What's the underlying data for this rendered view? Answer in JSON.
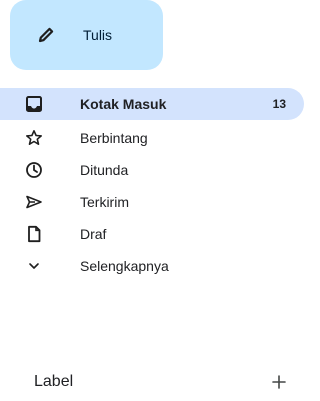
{
  "compose": {
    "label": "Tulis",
    "icon": "pencil-icon"
  },
  "nav": [
    {
      "label": "Kotak Masuk",
      "icon": "inbox-icon",
      "count": "13",
      "active": true
    },
    {
      "label": "Berbintang",
      "icon": "star-icon"
    },
    {
      "label": "Ditunda",
      "icon": "clock-icon"
    },
    {
      "label": "Terkirim",
      "icon": "send-icon"
    },
    {
      "label": "Draf",
      "icon": "draft-icon"
    },
    {
      "label": "Selengkapnya",
      "icon": "chevron-down-icon"
    }
  ],
  "labels": {
    "title": "Label",
    "add_icon": "plus-icon"
  },
  "colors": {
    "compose_bg": "#c2e7ff",
    "active_bg": "#d3e3fd",
    "text": "#202124"
  }
}
